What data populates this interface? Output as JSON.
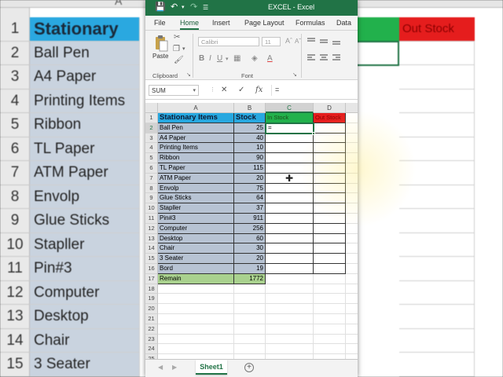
{
  "background": {
    "col_letter": "A",
    "row_numbers": [
      "1",
      "2",
      "3",
      "4",
      "5",
      "6",
      "7",
      "8",
      "9",
      "10",
      "11",
      "12",
      "13",
      "14",
      "15"
    ],
    "cells": [
      "Stationary",
      "Ball Pen",
      "A4 Paper",
      "Printing Items",
      "Ribbon",
      "TL Paper",
      "ATM Paper",
      "Envolp",
      "Glue Sticks",
      "Stapller",
      "Pin#3",
      "Computer",
      "Desktop",
      "Chair",
      "3 Seater"
    ],
    "out_stock": "Out Stock"
  },
  "window": {
    "title": "EXCEL  -  Excel",
    "tabs": [
      "File",
      "Home",
      "Insert",
      "Page Layout",
      "Formulas",
      "Data"
    ],
    "active_tab": "Home",
    "ribbon": {
      "clipboard_label": "Clipboard",
      "paste_label": "Paste",
      "font_label": "Font",
      "font_name": "Calibri",
      "font_size": "11"
    },
    "formula_bar": {
      "name_box": "SUM",
      "formula": "="
    },
    "grid": {
      "columns": [
        "A",
        "B",
        "C",
        "D"
      ],
      "rows": [
        "1",
        "2",
        "3",
        "4",
        "5",
        "6",
        "7",
        "8",
        "9",
        "10",
        "11",
        "12",
        "13",
        "14",
        "15",
        "16",
        "17",
        "18",
        "19",
        "20",
        "21",
        "22",
        "23",
        "24",
        "25"
      ],
      "headers": {
        "item": "Stationary Items",
        "stock": "Stock",
        "in_stock": "In Stock",
        "out_stock": "Out Stock"
      },
      "data": [
        {
          "item": "Ball Pen",
          "stock": "25"
        },
        {
          "item": "A4 Paper",
          "stock": "40"
        },
        {
          "item": "Printing Items",
          "stock": "10"
        },
        {
          "item": "Ribbon",
          "stock": "90"
        },
        {
          "item": "TL Paper",
          "stock": "115"
        },
        {
          "item": "ATM Paper",
          "stock": "20"
        },
        {
          "item": "Envolp",
          "stock": "75"
        },
        {
          "item": "Glue Sticks",
          "stock": "64"
        },
        {
          "item": "Stapller",
          "stock": "37"
        },
        {
          "item": "Pin#3",
          "stock": "911"
        },
        {
          "item": "Computer",
          "stock": "256"
        },
        {
          "item": "Desktop",
          "stock": "60"
        },
        {
          "item": "Chair",
          "stock": "30"
        },
        {
          "item": "3 Seater",
          "stock": "20"
        },
        {
          "item": "Bord",
          "stock": "19"
        }
      ],
      "remain": {
        "item": "Remain",
        "stock": "1772"
      },
      "active_cell_text": "="
    },
    "sheet_tab": "Sheet1",
    "add_sheet": "+"
  },
  "colors": {
    "excel_green": "#217346",
    "header_blue": "#27a8e0",
    "in_stock_green": "#22b14c",
    "out_stock_red": "#e51d1d",
    "item_fill": "#b7c3d3",
    "remain_fill": "#a9d18e"
  }
}
